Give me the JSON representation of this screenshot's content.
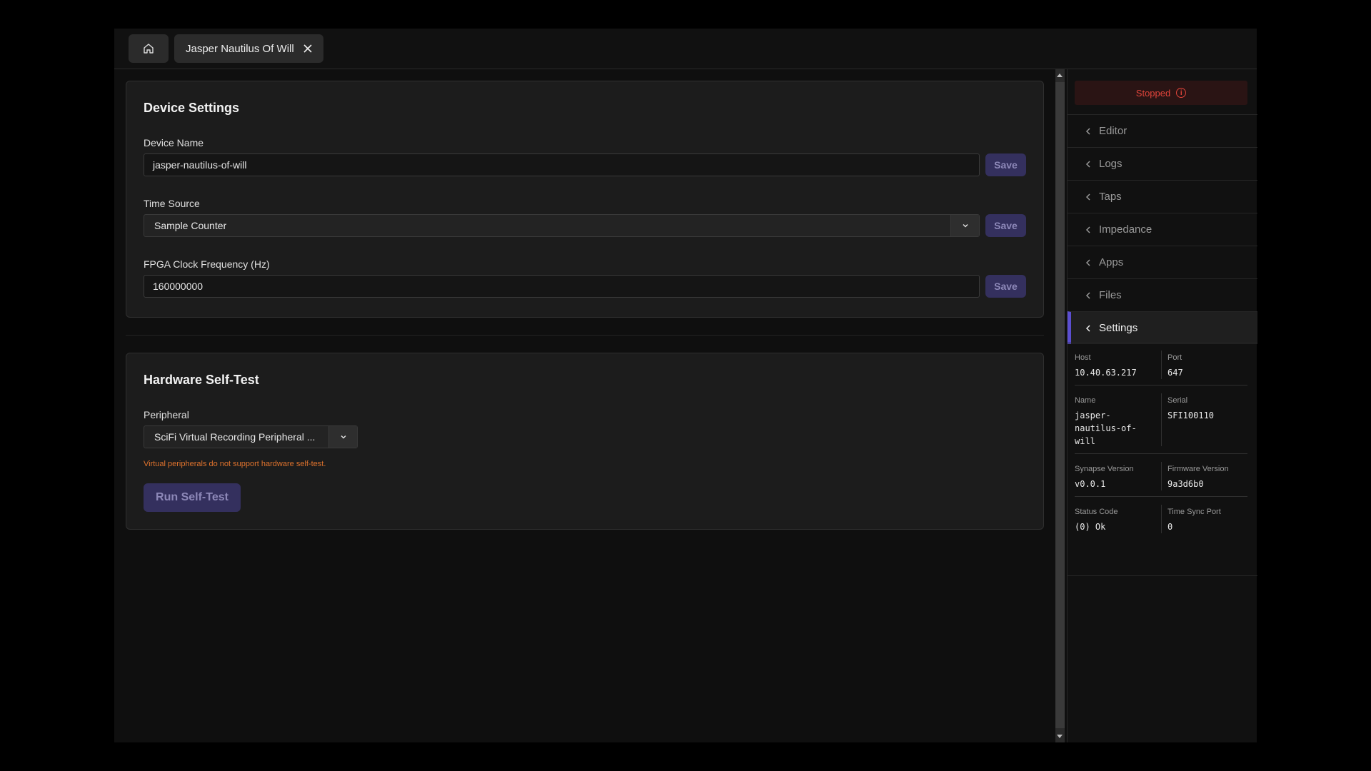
{
  "tabs": {
    "home_icon": "home-icon",
    "active_tab_label": "Jasper Nautilus Of Will",
    "close_icon": "close-icon"
  },
  "device_settings": {
    "title": "Device Settings",
    "device_name_label": "Device Name",
    "device_name_value": "jasper-nautilus-of-will",
    "time_source_label": "Time Source",
    "time_source_value": "Sample Counter",
    "fpga_label": "FPGA Clock Frequency (Hz)",
    "fpga_value": "160000000",
    "save_label": "Save"
  },
  "self_test": {
    "title": "Hardware Self-Test",
    "peripheral_label": "Peripheral",
    "peripheral_value": "SciFi Virtual Recording Peripheral ...",
    "warning": "Virtual peripherals do not support hardware self-test.",
    "run_label": "Run Self-Test"
  },
  "panel": {
    "status": "Stopped",
    "nav": [
      "Editor",
      "Logs",
      "Taps",
      "Impedance",
      "Apps",
      "Files",
      "Settings"
    ],
    "active_nav": "Settings",
    "info": {
      "host_label": "Host",
      "host_value": "10.40.63.217",
      "port_label": "Port",
      "port_value": "647",
      "name_label": "Name",
      "name_value": "jasper-nautilus-of-will",
      "serial_label": "Serial",
      "serial_value": "SFI100110",
      "synapse_label": "Synapse Version",
      "synapse_value": "v0.0.1",
      "firmware_label": "Firmware Version",
      "firmware_value": "9a3d6b0",
      "status_code_label": "Status Code",
      "status_code_value": "(0) Ok",
      "time_sync_label": "Time Sync Port",
      "time_sync_value": "0"
    }
  },
  "colors": {
    "accent": "#5b4ed1",
    "status_red": "#e0443a",
    "warning_orange": "#e0732d",
    "button_bg": "#34305e"
  }
}
